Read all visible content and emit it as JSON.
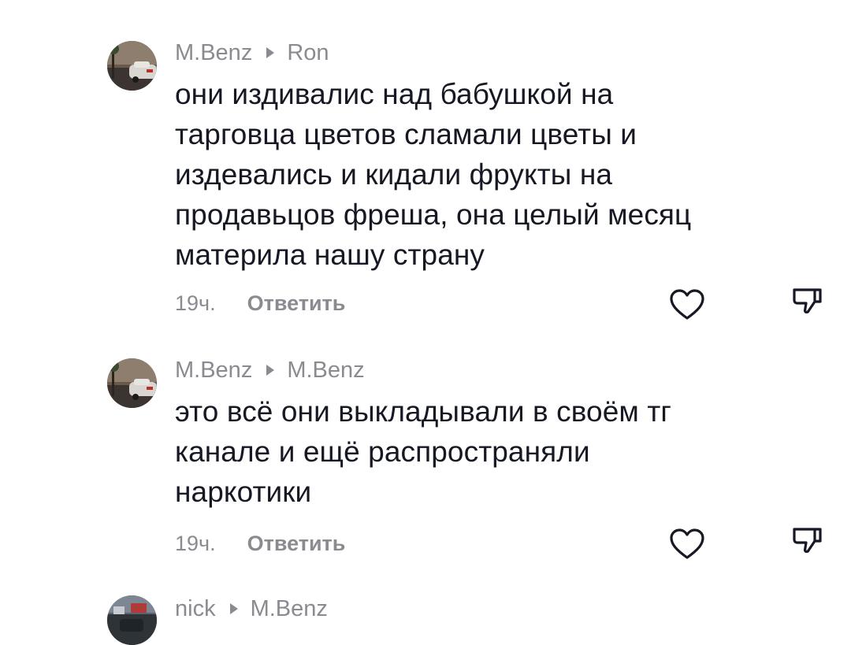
{
  "comments": [
    {
      "author": "M.Benz",
      "reply_to": "Ron",
      "lines": [
        "они издивалис над бабушкой на",
        "тарговца цветов сламали цветы и",
        "издевались и кидали фрукты на",
        "продавьцов фреша, она целый месяц",
        "материла нашу страну"
      ],
      "time": "19ч.",
      "reply_label": "Ответить",
      "like_icon": "heart-outline-icon",
      "dislike_icon": "thumb-down-icon"
    },
    {
      "author": "M.Benz",
      "reply_to": "M.Benz",
      "lines": [
        "это всё они выкладывали в своём тг",
        "канале и ещё распространяли",
        "наркотики"
      ],
      "time": "19ч.",
      "reply_label": "Ответить",
      "like_icon": "heart-outline-icon",
      "dislike_icon": "thumb-down-icon"
    },
    {
      "author": "nick",
      "reply_to": "M.Benz"
    }
  ],
  "colors": {
    "text": "#161823",
    "secondary": "#8a8b91",
    "background": "#ffffff"
  }
}
